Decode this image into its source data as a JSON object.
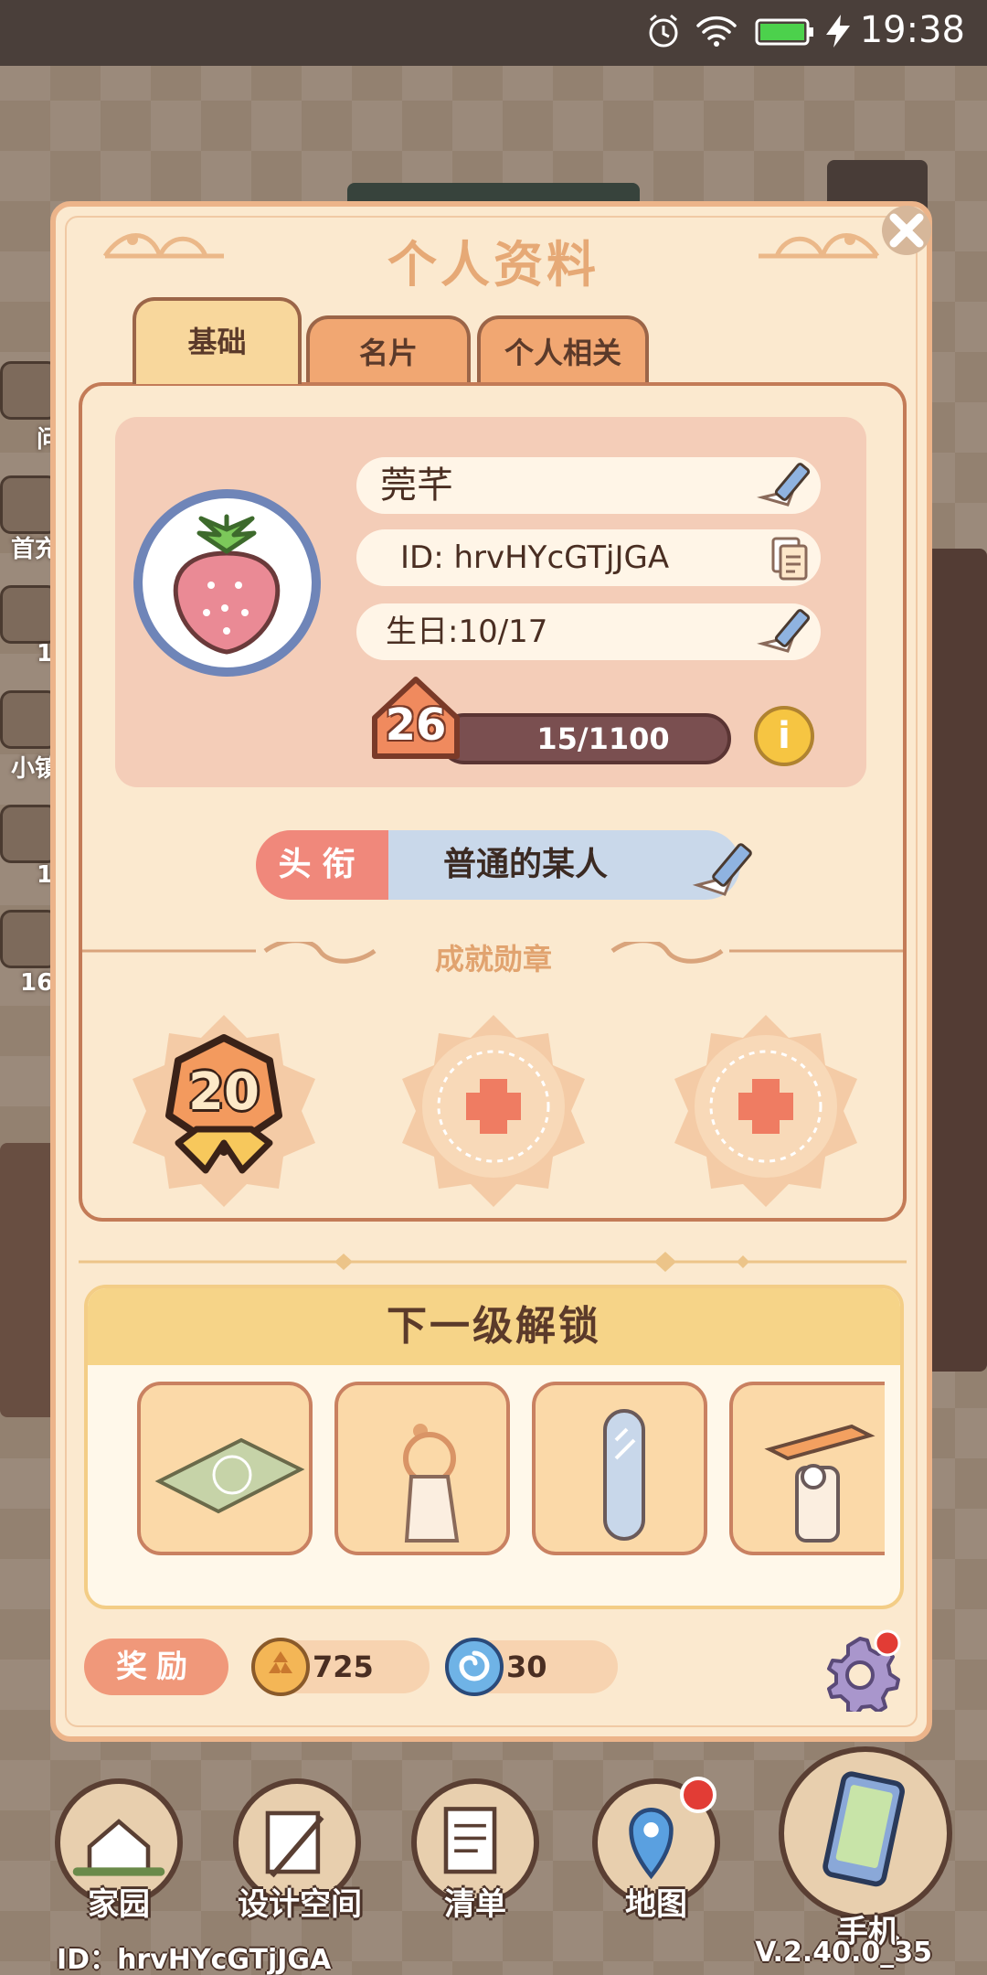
{
  "status_bar": {
    "time": "19:38",
    "icons": [
      "alarm-icon",
      "wifi-icon",
      "battery-icon",
      "charging-icon"
    ]
  },
  "side_hud": {
    "labels": [
      "问",
      "首充",
      "1",
      "小镇",
      "1",
      "16"
    ]
  },
  "dialog": {
    "title": "个人资料",
    "tabs": [
      {
        "label": "基础",
        "active": true
      },
      {
        "label": "名片",
        "active": false
      },
      {
        "label": "个人相关",
        "active": false
      }
    ],
    "profile": {
      "avatar_icon": "strawberry-icon",
      "name": "莞芊",
      "id": "ID: hrvHYcGTjJGA",
      "birthday": "生日:10/17",
      "level": "26",
      "exp": "15/1100",
      "info_symbol": "i"
    },
    "player_title": {
      "label": "头衔",
      "value": "普通的某人"
    },
    "achievements": {
      "label": "成就勋章",
      "medals": [
        {
          "type": "level-medal",
          "value": "20"
        },
        {
          "type": "empty-slot"
        },
        {
          "type": "empty-slot"
        }
      ]
    },
    "next_unlock": {
      "heading": "下一级解锁",
      "items": [
        "rug-icon",
        "towel-ring-icon",
        "mirror-icon",
        "toilet-paper-holder-icon"
      ]
    },
    "rewards": {
      "label": "奖励",
      "items": [
        {
          "icon": "coin-icon",
          "amount": "725"
        },
        {
          "icon": "swirl-gem-icon",
          "amount": "30"
        }
      ]
    }
  },
  "bottom_hud": {
    "buttons": [
      {
        "label": "家园",
        "icon": "home-icon"
      },
      {
        "label": "设计空间",
        "icon": "design-icon"
      },
      {
        "label": "清单",
        "icon": "list-icon"
      },
      {
        "label": "地图",
        "icon": "map-pin-icon"
      },
      {
        "label": "手机",
        "icon": "phone-icon"
      }
    ],
    "player_id": "ID：hrvHYcGTjJGA",
    "version": "V.2.40.0_35"
  },
  "colors": {
    "panel": "#fbe9cf",
    "accent": "#f1a772",
    "title": "#e6a976",
    "exp_bar": "#7a4f50",
    "badge_red": "#e23c35"
  }
}
